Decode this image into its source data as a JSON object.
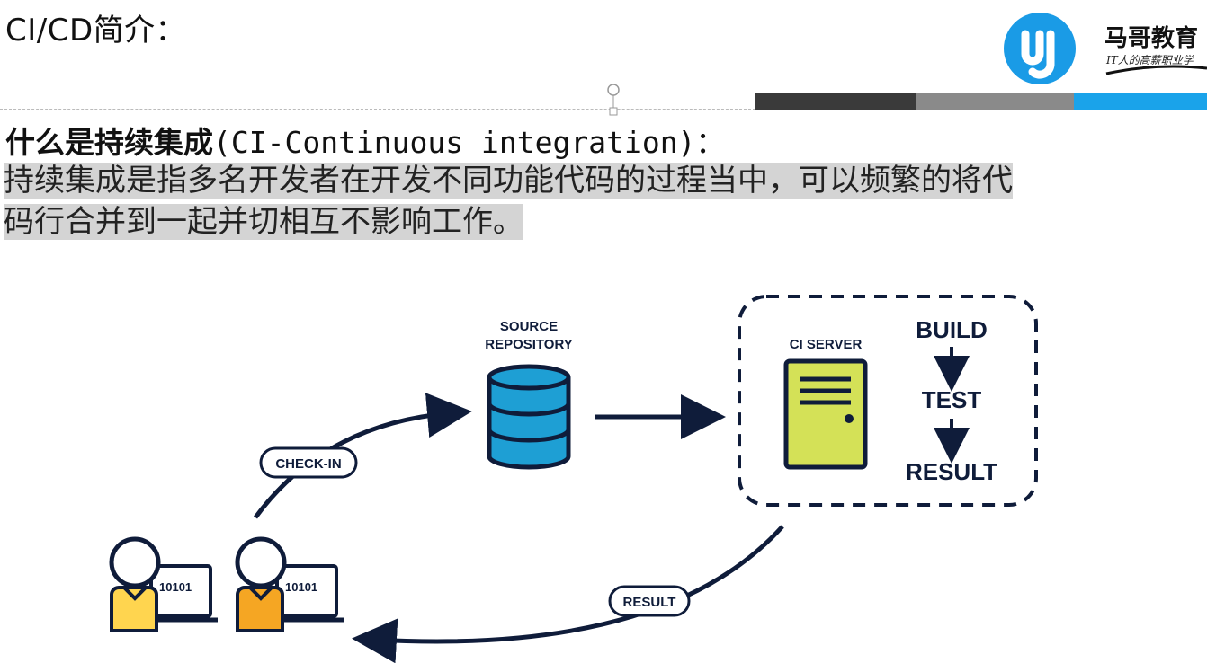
{
  "slide": {
    "title": "CI/CD简介：",
    "question_cn": "什么是持续集成",
    "question_en": "(CI-Continuous integration)：",
    "answer_line1": "持续集成是指多名开发者在开发不同功能代码的过程当中，可以频繁的将代",
    "answer_line2": "码行合并到一起并切相互不影响工作。"
  },
  "logo": {
    "brand": "马哥教育",
    "slogan": "IT人的高薪职业学",
    "icon": "magedu-logo-icon",
    "color": "#1a9be6"
  },
  "header_band": {
    "colors": [
      "#3a3a3a",
      "#8a8a8a",
      "#1aa3ea"
    ]
  },
  "diagram": {
    "source_label_1": "SOURCE",
    "source_label_2": "REPOSITORY",
    "ci_server_label": "CI SERVER",
    "step_build": "BUILD",
    "step_test": "TEST",
    "step_result": "RESULT",
    "checkin_label": "CHECK-IN",
    "result_label": "RESULT",
    "dev1_binary": "10101",
    "dev2_binary": "10101",
    "colors": {
      "navy": "#0f1c3a",
      "database": "#1e9fd4",
      "server": "#d4e157",
      "developer1": "#ffd54f",
      "developer2": "#f5a623"
    }
  }
}
